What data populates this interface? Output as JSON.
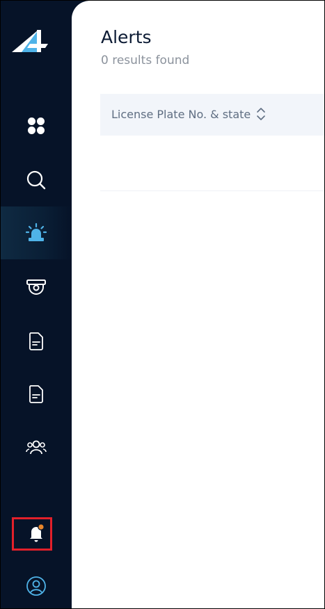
{
  "sidebar": {
    "items": [
      {
        "name": "dashboard",
        "icon": "grid-icon",
        "active": false
      },
      {
        "name": "search",
        "icon": "search-icon",
        "active": false
      },
      {
        "name": "alerts",
        "icon": "siren-icon",
        "active": true
      },
      {
        "name": "cameras",
        "icon": "camera-icon",
        "active": false
      },
      {
        "name": "reports",
        "icon": "document-icon",
        "active": false
      },
      {
        "name": "documents",
        "icon": "document-icon",
        "active": false
      },
      {
        "name": "users",
        "icon": "users-icon",
        "active": false
      },
      {
        "name": "notifications",
        "icon": "bell-icon",
        "active": false,
        "has_badge": true
      },
      {
        "name": "profile",
        "icon": "user-circle-icon",
        "active": false
      }
    ],
    "colors": {
      "background": "#061328",
      "icon": "#ffffff",
      "active_icon": "#4fb3e8",
      "badge": "#e8862b",
      "highlight": "#e2202a"
    }
  },
  "main": {
    "title": "Alerts",
    "results_text": "0 results found",
    "table": {
      "columns": [
        {
          "label": "License Plate No. & state",
          "sortable": true
        }
      ],
      "rows": []
    }
  }
}
